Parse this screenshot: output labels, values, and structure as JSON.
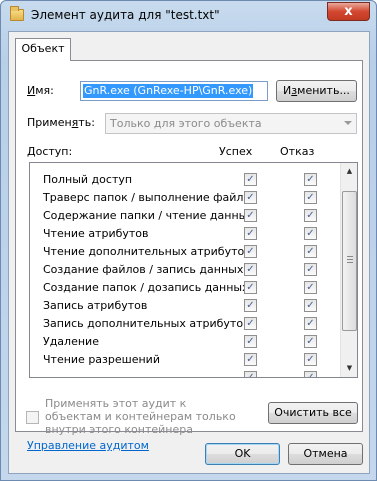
{
  "window": {
    "title": "Элемент аудита для \"test.txt\"",
    "close_symbol": "x"
  },
  "tabs": [
    {
      "label": "Объект"
    }
  ],
  "name": {
    "label_prefix": "",
    "label_hotkey": "И",
    "label_rest": "мя:",
    "value": "GnR.exe (GnRexe-HP\\GnR.exe)",
    "change_button": {
      "prefix": "И",
      "hotkey": "з",
      "rest": "менить..."
    }
  },
  "apply": {
    "label_prefix": "Примен",
    "label_hotkey": "я",
    "label_rest": "ть:",
    "value": "Только для этого объекта"
  },
  "access": {
    "label_prefix": "",
    "label_hotkey": "Д",
    "label_rest": "оступ:",
    "col_success": "Успех",
    "col_failure": "Отказ",
    "check_symbol": "✓",
    "rows": [
      {
        "label": "Полный доступ",
        "success": true,
        "failure": true
      },
      {
        "label": "Траверс папок / выполнение файлов",
        "success": true,
        "failure": true
      },
      {
        "label": "Содержание папки / чтение данных",
        "success": true,
        "failure": true
      },
      {
        "label": "Чтение атрибутов",
        "success": true,
        "failure": true
      },
      {
        "label": "Чтение дополнительных атрибутов",
        "success": true,
        "failure": true
      },
      {
        "label": "Создание файлов / запись данных",
        "success": true,
        "failure": true
      },
      {
        "label": "Создание папок / дозапись данных",
        "success": true,
        "failure": true
      },
      {
        "label": "Запись атрибутов",
        "success": true,
        "failure": true
      },
      {
        "label": "Запись дополнительных атрибутов",
        "success": true,
        "failure": true
      },
      {
        "label": "Удаление",
        "success": true,
        "failure": true
      },
      {
        "label": "Чтение разрешений",
        "success": true,
        "failure": true
      },
      {
        "label": "",
        "success": true,
        "failure": true
      }
    ],
    "scroll_up": "▲",
    "scroll_down": "▼"
  },
  "apply_inside": {
    "label": "Применять этот аудит к объектам и контейнерам только внутри этого контейнера",
    "checked": false
  },
  "clear_all_button": "Очистить все",
  "manage_audit_link": "Управление аудитом",
  "buttons": {
    "ok": "OK",
    "cancel": "Отмена"
  }
}
